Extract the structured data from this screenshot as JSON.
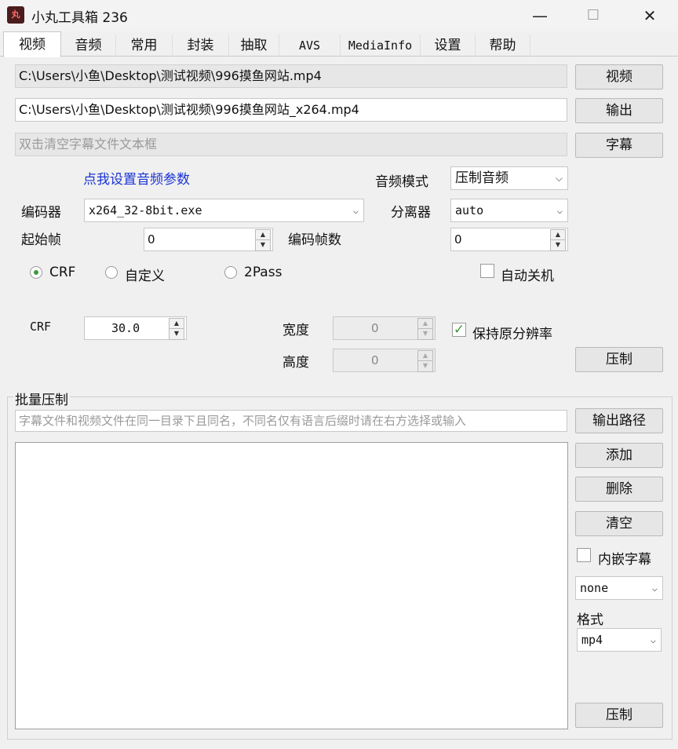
{
  "window": {
    "title": "小丸工具箱 236",
    "icon_text": "丸",
    "minimize": "—",
    "maximize": "☐",
    "close": "✕"
  },
  "tabs": [
    "视频",
    "音频",
    "常用",
    "封装",
    "抽取",
    "AVS",
    "MediaInfo",
    "设置",
    "帮助"
  ],
  "video": {
    "input_path": "C:\\Users\\小鱼\\Desktop\\测试视频\\996摸鱼网站.mp4",
    "output_path": "C:\\Users\\小鱼\\Desktop\\测试视频\\996摸鱼网站_x264.mp4",
    "subtitle_placeholder": "双击清空字幕文件文本框",
    "btn_video": "视频",
    "btn_output": "输出",
    "btn_subtitle": "字幕",
    "audio_link": "点我设置音频参数",
    "audio_mode_label": "音频模式",
    "audio_mode_value": "压制音频",
    "encoder_label": "编码器",
    "encoder_value": "x264_32-8bit.exe",
    "demuxer_label": "分离器",
    "demuxer_value": "auto",
    "start_frame_label": "起始帧",
    "start_frame_value": "0",
    "encode_frames_label": "编码帧数",
    "encode_frames_value": "0",
    "mode_crf": "CRF",
    "mode_custom": "自定义",
    "mode_2pass": "2Pass",
    "auto_shutdown": "自动关机",
    "crf_label": "CRF",
    "crf_value": "30.0",
    "width_label": "宽度",
    "width_value": "0",
    "height_label": "高度",
    "height_value": "0",
    "keep_res": "保持原分辨率",
    "btn_encode": "压制"
  },
  "batch": {
    "group_title": "批量压制",
    "hint_placeholder": "字幕文件和视频文件在同一目录下且同名，不同名仅有语言后缀时请在右方选择或输入",
    "btn_output_path": "输出路径",
    "btn_add": "添加",
    "btn_delete": "删除",
    "btn_clear": "清空",
    "embed_subtitle": "内嵌字幕",
    "subtitle_lang_value": "none",
    "format_label": "格式",
    "format_value": "mp4",
    "btn_encode": "压制"
  }
}
